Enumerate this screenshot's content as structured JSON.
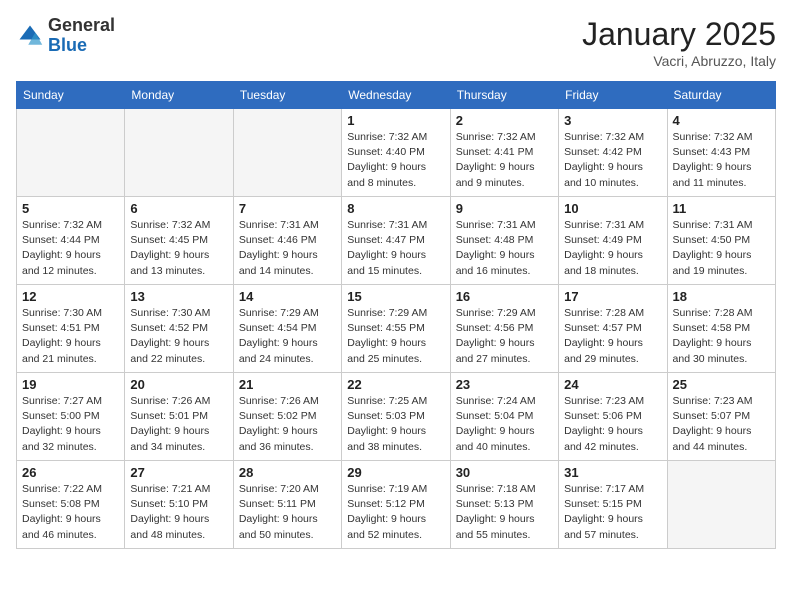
{
  "header": {
    "logo_general": "General",
    "logo_blue": "Blue",
    "month": "January 2025",
    "location": "Vacri, Abruzzo, Italy"
  },
  "days_of_week": [
    "Sunday",
    "Monday",
    "Tuesday",
    "Wednesday",
    "Thursday",
    "Friday",
    "Saturday"
  ],
  "weeks": [
    [
      null,
      null,
      null,
      {
        "day": 1,
        "sunrise": "7:32 AM",
        "sunset": "4:40 PM",
        "daylight": "9 hours and 8 minutes."
      },
      {
        "day": 2,
        "sunrise": "7:32 AM",
        "sunset": "4:41 PM",
        "daylight": "9 hours and 9 minutes."
      },
      {
        "day": 3,
        "sunrise": "7:32 AM",
        "sunset": "4:42 PM",
        "daylight": "9 hours and 10 minutes."
      },
      {
        "day": 4,
        "sunrise": "7:32 AM",
        "sunset": "4:43 PM",
        "daylight": "9 hours and 11 minutes."
      }
    ],
    [
      {
        "day": 5,
        "sunrise": "7:32 AM",
        "sunset": "4:44 PM",
        "daylight": "9 hours and 12 minutes."
      },
      {
        "day": 6,
        "sunrise": "7:32 AM",
        "sunset": "4:45 PM",
        "daylight": "9 hours and 13 minutes."
      },
      {
        "day": 7,
        "sunrise": "7:31 AM",
        "sunset": "4:46 PM",
        "daylight": "9 hours and 14 minutes."
      },
      {
        "day": 8,
        "sunrise": "7:31 AM",
        "sunset": "4:47 PM",
        "daylight": "9 hours and 15 minutes."
      },
      {
        "day": 9,
        "sunrise": "7:31 AM",
        "sunset": "4:48 PM",
        "daylight": "9 hours and 16 minutes."
      },
      {
        "day": 10,
        "sunrise": "7:31 AM",
        "sunset": "4:49 PM",
        "daylight": "9 hours and 18 minutes."
      },
      {
        "day": 11,
        "sunrise": "7:31 AM",
        "sunset": "4:50 PM",
        "daylight": "9 hours and 19 minutes."
      }
    ],
    [
      {
        "day": 12,
        "sunrise": "7:30 AM",
        "sunset": "4:51 PM",
        "daylight": "9 hours and 21 minutes."
      },
      {
        "day": 13,
        "sunrise": "7:30 AM",
        "sunset": "4:52 PM",
        "daylight": "9 hours and 22 minutes."
      },
      {
        "day": 14,
        "sunrise": "7:29 AM",
        "sunset": "4:54 PM",
        "daylight": "9 hours and 24 minutes."
      },
      {
        "day": 15,
        "sunrise": "7:29 AM",
        "sunset": "4:55 PM",
        "daylight": "9 hours and 25 minutes."
      },
      {
        "day": 16,
        "sunrise": "7:29 AM",
        "sunset": "4:56 PM",
        "daylight": "9 hours and 27 minutes."
      },
      {
        "day": 17,
        "sunrise": "7:28 AM",
        "sunset": "4:57 PM",
        "daylight": "9 hours and 29 minutes."
      },
      {
        "day": 18,
        "sunrise": "7:28 AM",
        "sunset": "4:58 PM",
        "daylight": "9 hours and 30 minutes."
      }
    ],
    [
      {
        "day": 19,
        "sunrise": "7:27 AM",
        "sunset": "5:00 PM",
        "daylight": "9 hours and 32 minutes."
      },
      {
        "day": 20,
        "sunrise": "7:26 AM",
        "sunset": "5:01 PM",
        "daylight": "9 hours and 34 minutes."
      },
      {
        "day": 21,
        "sunrise": "7:26 AM",
        "sunset": "5:02 PM",
        "daylight": "9 hours and 36 minutes."
      },
      {
        "day": 22,
        "sunrise": "7:25 AM",
        "sunset": "5:03 PM",
        "daylight": "9 hours and 38 minutes."
      },
      {
        "day": 23,
        "sunrise": "7:24 AM",
        "sunset": "5:04 PM",
        "daylight": "9 hours and 40 minutes."
      },
      {
        "day": 24,
        "sunrise": "7:23 AM",
        "sunset": "5:06 PM",
        "daylight": "9 hours and 42 minutes."
      },
      {
        "day": 25,
        "sunrise": "7:23 AM",
        "sunset": "5:07 PM",
        "daylight": "9 hours and 44 minutes."
      }
    ],
    [
      {
        "day": 26,
        "sunrise": "7:22 AM",
        "sunset": "5:08 PM",
        "daylight": "9 hours and 46 minutes."
      },
      {
        "day": 27,
        "sunrise": "7:21 AM",
        "sunset": "5:10 PM",
        "daylight": "9 hours and 48 minutes."
      },
      {
        "day": 28,
        "sunrise": "7:20 AM",
        "sunset": "5:11 PM",
        "daylight": "9 hours and 50 minutes."
      },
      {
        "day": 29,
        "sunrise": "7:19 AM",
        "sunset": "5:12 PM",
        "daylight": "9 hours and 52 minutes."
      },
      {
        "day": 30,
        "sunrise": "7:18 AM",
        "sunset": "5:13 PM",
        "daylight": "9 hours and 55 minutes."
      },
      {
        "day": 31,
        "sunrise": "7:17 AM",
        "sunset": "5:15 PM",
        "daylight": "9 hours and 57 minutes."
      },
      null
    ]
  ]
}
